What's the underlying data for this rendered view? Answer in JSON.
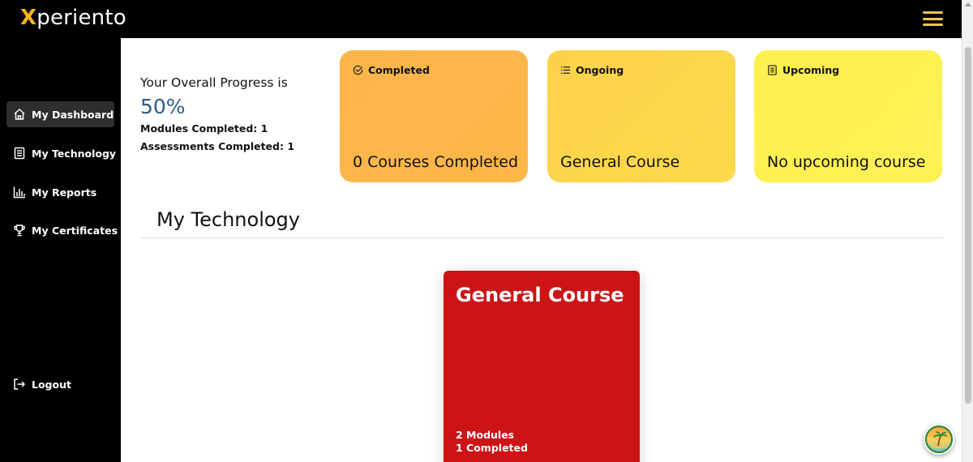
{
  "brand": {
    "logo_first": "X",
    "logo_rest": "periento",
    "accent": "#f5b21b"
  },
  "header": {
    "menu_icon": "hamburger-menu-icon"
  },
  "sidebar": {
    "items": [
      {
        "label": "My Dashboard",
        "icon": "home-icon",
        "active": true
      },
      {
        "label": "My Technology",
        "icon": "document-icon",
        "active": false
      },
      {
        "label": "My Reports",
        "icon": "bar-chart-icon",
        "active": false
      },
      {
        "label": "My Certificates",
        "icon": "trophy-icon",
        "active": false
      }
    ],
    "logout": {
      "label": "Logout",
      "icon": "logout-icon"
    }
  },
  "progress": {
    "heading": "Your Overall Progress is",
    "percent": "50%",
    "modules_completed": "Modules Completed: 1",
    "assessments_completed": "Assessments Completed: 1"
  },
  "cards": {
    "completed": {
      "label": "Completed",
      "value": "0 Courses Completed",
      "icon": "check-circle-icon",
      "color": "#fdb54a"
    },
    "ongoing": {
      "label": "Ongoing",
      "value": "General Course",
      "icon": "list-icon",
      "color": "#fdd44a"
    },
    "upcoming": {
      "label": "Upcoming",
      "value": "No upcoming course",
      "icon": "notes-icon",
      "color": "#fef04d"
    }
  },
  "technology": {
    "title": "My Technology",
    "course": {
      "title": "General Course",
      "modules": "2 Modules",
      "completed": "1 Completed",
      "color": "#cc1416"
    }
  },
  "fab": {
    "icon": "beach-avatar-icon"
  }
}
